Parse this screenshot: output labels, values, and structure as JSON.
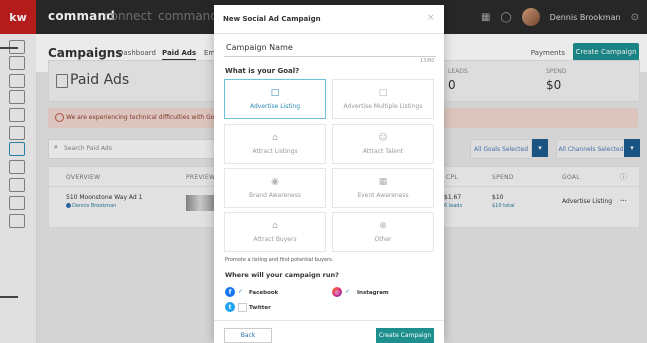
{
  "topbar": {
    "logo": "kw",
    "brand": "command",
    "sub1": "connect",
    "sub2": "command",
    "user": "Dennis Brookman"
  },
  "subnav": {
    "title": "Campaigns",
    "tabs": [
      "Dashboard",
      "Paid Ads",
      "Em"
    ],
    "payments": "Payments",
    "create": "Create Campaign"
  },
  "page": {
    "title": "Paid Ads",
    "leads_label": "LEADS",
    "leads_value": "0",
    "spend_label": "SPEND",
    "spend_value": "$0",
    "alert": "We are experiencing technical difficulties with Google Se",
    "search_placeholder": "Search Paid Ads",
    "all_goals": "All Goals Selected",
    "all_channels": "All Channels Selected"
  },
  "table": {
    "headers": [
      "OVERVIEW",
      "PREVIEW",
      "CPL",
      "SPEND",
      "GOAL"
    ],
    "row": {
      "title": "510 Moonstone Way Ad 1",
      "owner": "Dennis Brookman",
      "cpl": "$1.67",
      "cpl_sub": "6 leads",
      "spend": "$10",
      "spend_sub": "$10 total",
      "goal": "Advertise Listing",
      "menu": "..."
    }
  },
  "modal": {
    "title": "New Social Ad Campaign",
    "close": "×",
    "campaign_name": "Campaign Name",
    "char_count": "13/80",
    "goal_question": "What is your Goal?",
    "goals": [
      {
        "label": "Advertise Listing",
        "icon": "□"
      },
      {
        "label": "Advertise Multiple Listings",
        "icon": "□"
      },
      {
        "label": "Attract Listings",
        "icon": "⌂"
      },
      {
        "label": "Attract Talent",
        "icon": "☺"
      },
      {
        "label": "Brand Awareness",
        "icon": "◉"
      },
      {
        "label": "Event Awareness",
        "icon": "▦"
      },
      {
        "label": "Attract Buyers",
        "icon": "⌂"
      },
      {
        "label": "Other",
        "icon": "⊕"
      }
    ],
    "goal_description": "Promote a listing and find potential buyers.",
    "run_question": "Where will your campaign run?",
    "channels": {
      "facebook": "Facebook",
      "instagram": "Instagram",
      "twitter": "Twitter"
    },
    "back": "Back",
    "create": "Create Campaign"
  },
  "colors": {
    "teal": "#1d8f8f",
    "selected_border": "#6ec3d8",
    "kw_red": "#c41e1e"
  }
}
